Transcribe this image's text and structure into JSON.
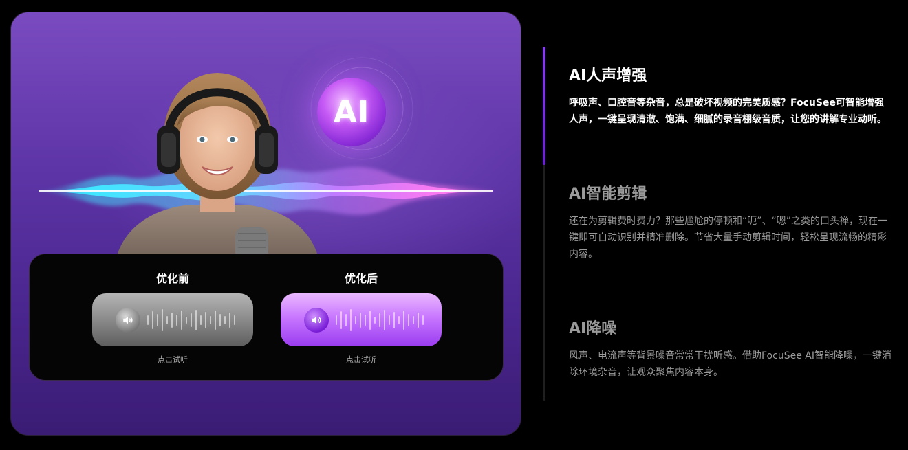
{
  "compare": {
    "before": {
      "title": "优化前",
      "hint": "点击试听"
    },
    "after": {
      "title": "优化后",
      "hint": "点击试听"
    }
  },
  "ai_badge": "AI",
  "features": [
    {
      "title": "AI人声增强",
      "desc": "呼吸声、口腔音等杂音，总是破坏视频的完美质感？FocuSee可智能增强人声，一键呈现清澈、饱满、细腻的录音棚级音质，让您的讲解专业动听。",
      "active": true
    },
    {
      "title": "AI智能剪辑",
      "desc": "还在为剪辑费时费力？那些尴尬的停顿和“呃”、“嗯”之类的口头禅，现在一键即可自动识别并精准删除。节省大量手动剪辑时间，轻松呈现流畅的精彩内容。",
      "active": false
    },
    {
      "title": "AI降噪",
      "desc": "风声、电流声等背景噪音常常干扰听感。借助FocuSee AI智能降噪，一键消除环境杂音，让观众聚焦内容本身。",
      "active": false
    }
  ],
  "colors": {
    "accent": "#8a3cf0",
    "card_top": "#7a4bc0",
    "card_bottom": "#3a1c74",
    "inactive_text": "#9a9a9a"
  }
}
